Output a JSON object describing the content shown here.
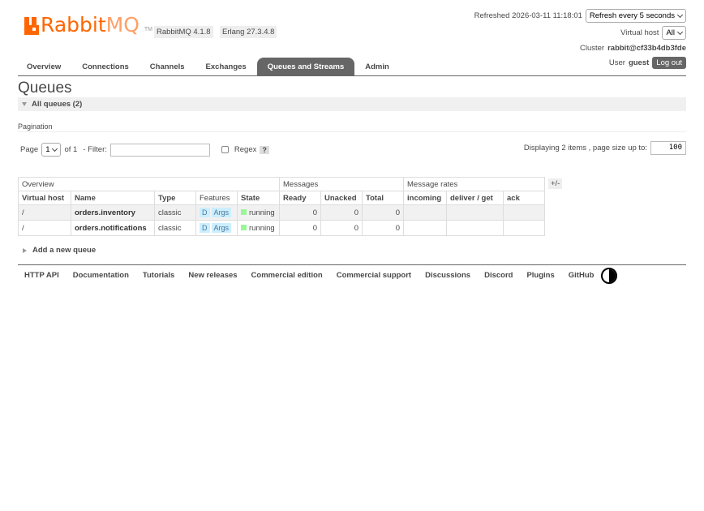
{
  "header": {
    "logo_main": "Rabbit",
    "logo_mq": "MQ",
    "logo_tm": "TM",
    "rabbitmq_version": "RabbitMQ 4.1.8",
    "erlang_version": "Erlang 27.3.4.8",
    "refreshed_label": "Refreshed 2026-03-11 11:18:01",
    "refresh_select": "Refresh every 5 seconds",
    "vhost_label": "Virtual host",
    "vhost_select": "All",
    "cluster_label": "Cluster",
    "cluster_name": "rabbit@cf33b4db3fde",
    "user_label": "User",
    "user_name": "guest",
    "logout_label": "Log out"
  },
  "tabs": [
    {
      "label": "Overview"
    },
    {
      "label": "Connections"
    },
    {
      "label": "Channels"
    },
    {
      "label": "Exchanges"
    },
    {
      "label": "Queues and Streams",
      "active": true
    },
    {
      "label": "Admin"
    }
  ],
  "page": {
    "title": "Queues",
    "section_title": "All queues (2)",
    "pagination_label": "Pagination"
  },
  "pagination": {
    "page_label": "Page",
    "page_value": "1",
    "of_label": "of 1",
    "filter_label": "- Filter:",
    "filter_value": "",
    "regex_label": "Regex",
    "help_label": "?",
    "display_info": "Displaying 2 items , page size up to:",
    "page_size": "100"
  },
  "table": {
    "groups": [
      "Overview",
      "Messages",
      "Message rates"
    ],
    "plus_minus": "+/-",
    "columns": [
      "Virtual host",
      "Name",
      "Type",
      "Features",
      "State",
      "Ready",
      "Unacked",
      "Total",
      "incoming",
      "deliver / get",
      "ack"
    ],
    "rows": [
      {
        "vhost": "/",
        "name": "orders.inventory",
        "type": "classic",
        "feature_d": "D",
        "feature_args": "Args",
        "state": "running",
        "ready": "0",
        "unacked": "0",
        "total": "0",
        "incoming": "",
        "deliver_get": "",
        "ack": ""
      },
      {
        "vhost": "/",
        "name": "orders.notifications",
        "type": "classic",
        "feature_d": "D",
        "feature_args": "Args",
        "state": "running",
        "ready": "0",
        "unacked": "0",
        "total": "0",
        "incoming": "",
        "deliver_get": "",
        "ack": ""
      }
    ]
  },
  "add_queue_label": "Add a new queue",
  "footer": {
    "links": [
      "HTTP API",
      "Documentation",
      "Tutorials",
      "New releases",
      "Commercial edition",
      "Commercial support",
      "Discussions",
      "Discord",
      "Plugins",
      "GitHub"
    ]
  },
  "colors": {
    "brand_orange": "#ff6600",
    "tab_active_bg": "#666666",
    "feature_badge_bg": "#cceeff",
    "state_running": "#98f898"
  }
}
